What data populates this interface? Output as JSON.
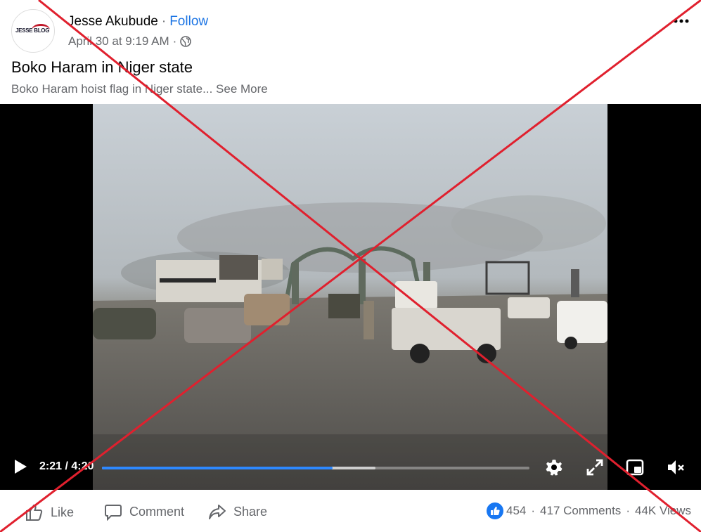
{
  "post": {
    "author": "Jesse Akubude",
    "separator": "·",
    "follow_label": "Follow",
    "timestamp": "April 30 at 9:19 AM",
    "meta_separator": "·",
    "privacy_icon": "globe-icon",
    "more_icon": "more-options-icon",
    "title": "Boko Haram in Niger state",
    "description": "Boko Haram hoist flag in Niger state...",
    "see_more": "See More",
    "avatar_text": "JESSE BLOG"
  },
  "video": {
    "time": "2:21 / 4:20",
    "progress_fraction": 0.54,
    "buffered_fraction": 0.64,
    "icons": [
      "play-icon",
      "settings-icon",
      "fullscreen-icon",
      "miniplayer-icon",
      "muted-volume-icon"
    ]
  },
  "actions": {
    "like_label": "Like",
    "comment_label": "Comment",
    "share_label": "Share"
  },
  "stats": {
    "reactions": "454",
    "comments": "417 Comments",
    "views": "44K Views",
    "separator": "·"
  },
  "colors": {
    "accent": "#1b74e4",
    "progress": "#2d88ff",
    "cross": "#e0202e",
    "muted_text": "#65676b"
  }
}
